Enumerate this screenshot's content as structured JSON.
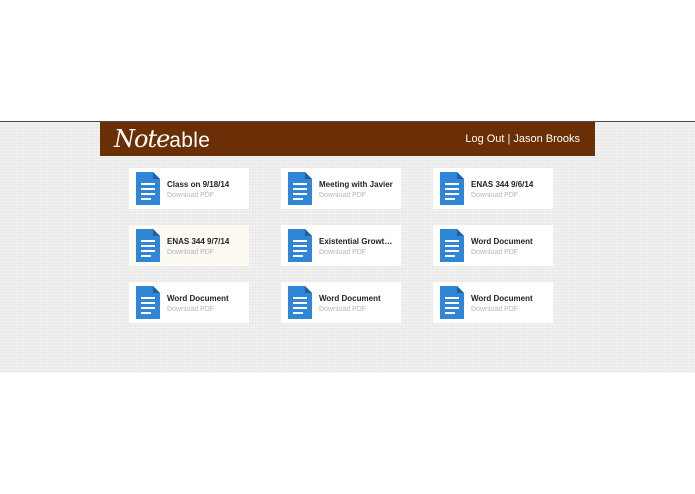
{
  "brand": {
    "logo_script": "Note",
    "logo_rest": "able",
    "color": "#6b2f05"
  },
  "nav": {
    "logout_label": "Log Out",
    "separator": "|",
    "user_name": "Jason Brooks"
  },
  "documents": [
    {
      "title": "Class on 9/18/14",
      "action": "Download PDF",
      "icon": "document-icon"
    },
    {
      "title": "Meeting with Javier",
      "action": "Download PDF",
      "icon": "document-icon"
    },
    {
      "title": "ENAS 344 9/6/14",
      "action": "Download PDF",
      "icon": "document-icon"
    },
    {
      "title": "ENAS 344 9/7/14",
      "action": "Download PDF",
      "icon": "document-icon",
      "highlighted": true
    },
    {
      "title": "Existential Growt…",
      "action": "Download PDF",
      "icon": "document-icon"
    },
    {
      "title": "Word Document",
      "action": "Download PDF",
      "icon": "document-icon"
    },
    {
      "title": "Word Document",
      "action": "Download PDF",
      "icon": "document-icon"
    },
    {
      "title": "Word Document",
      "action": "Download PDF",
      "icon": "document-icon"
    },
    {
      "title": "Word Document",
      "action": "Download PDF",
      "icon": "document-icon"
    }
  ],
  "colors": {
    "doc_icon": "#2f86d6",
    "highlight_card": "#fdf9f3"
  }
}
